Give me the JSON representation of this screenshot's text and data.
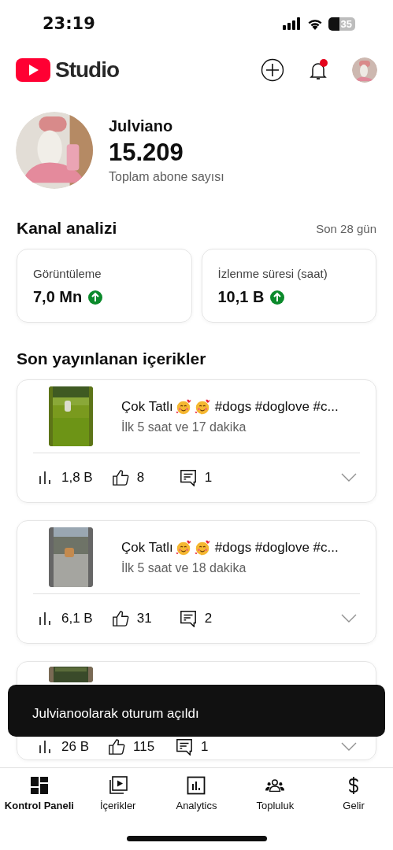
{
  "status_bar": {
    "time": "23:19",
    "battery": "35"
  },
  "header": {
    "logo_text": "Studio",
    "notification_dot": true
  },
  "channel": {
    "name": "Julviano",
    "subscribers": "15.209",
    "subscribers_label": "Toplam abone sayısı"
  },
  "analytics": {
    "title": "Kanal analizi",
    "period": "Son 28 gün",
    "metrics": [
      {
        "label": "Görüntüleme",
        "value": "7,0 Mn"
      },
      {
        "label": "İzlenme süresi (saat)",
        "value": "10,1 B"
      }
    ]
  },
  "recent": {
    "title": "Son yayınlanan içerikler",
    "items": [
      {
        "kind": "full",
        "title": "Çok Tatlı",
        "tags": "#dogs #doglove #c...",
        "subtitle": "İlk 5 saat ve 17 dakika",
        "views": "1,8 B",
        "likes": "8",
        "comments": "1"
      },
      {
        "kind": "full",
        "title": "Çok Tatlı",
        "tags": "#dogs #doglove #c...",
        "subtitle": "İlk 5 saat ve 18 dakika",
        "views": "6,1 B",
        "likes": "31",
        "comments": "2"
      },
      {
        "kind": "covered",
        "views": "26 B",
        "likes": "115",
        "comments": "1"
      }
    ]
  },
  "toast": {
    "text": "Julvianoolarak oturum açıldı"
  },
  "nav": [
    {
      "label": "Kontrol Paneli",
      "selected": true
    },
    {
      "label": "İçerikler",
      "selected": false
    },
    {
      "label": "Analytics",
      "selected": false
    },
    {
      "label": "Topluluk",
      "selected": false
    },
    {
      "label": "Gelir",
      "selected": false
    }
  ]
}
